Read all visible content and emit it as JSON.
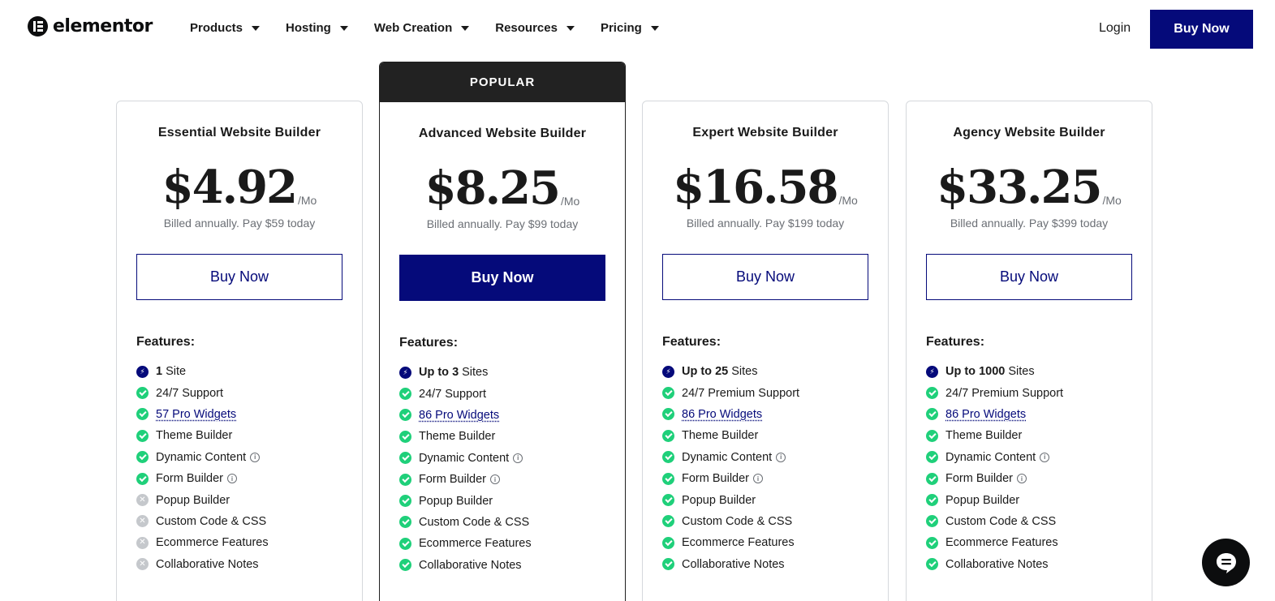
{
  "header": {
    "brand": "elementor",
    "nav": [
      {
        "label": "Products"
      },
      {
        "label": "Hosting"
      },
      {
        "label": "Web Creation"
      },
      {
        "label": "Resources"
      },
      {
        "label": "Pricing"
      }
    ],
    "login_label": "Login",
    "buy_label": "Buy Now",
    "accent_color": "#050a7a"
  },
  "plans": [
    {
      "title": "Essential Website Builder",
      "price": "$4.92",
      "per": "/Mo",
      "billed": "Billed annually. Pay $59 today",
      "cta": "Buy Now",
      "popular": false,
      "features_label": "Features:",
      "sites_bold": "1",
      "sites_text": "Site",
      "support": "24/7 Support",
      "widgets": "57 Pro Widgets",
      "features": [
        {
          "label": "Theme Builder",
          "status": "included",
          "info": false
        },
        {
          "label": "Dynamic Content",
          "status": "included",
          "info": true
        },
        {
          "label": "Form Builder",
          "status": "included",
          "info": true
        },
        {
          "label": "Popup Builder",
          "status": "excluded",
          "info": false
        },
        {
          "label": "Custom Code & CSS",
          "status": "excluded",
          "info": false
        },
        {
          "label": "Ecommerce Features",
          "status": "excluded",
          "info": false
        },
        {
          "label": "Collaborative Notes",
          "status": "excluded",
          "info": false
        }
      ]
    },
    {
      "title": "Advanced Website Builder",
      "price": "$8.25",
      "per": "/Mo",
      "billed": "Billed annually. Pay $99 today",
      "cta": "Buy Now",
      "popular": true,
      "popular_label": "POPULAR",
      "features_label": "Features:",
      "sites_bold": "Up to 3",
      "sites_text": "Sites",
      "support": "24/7 Support",
      "widgets": "86 Pro Widgets",
      "features": [
        {
          "label": "Theme Builder",
          "status": "included",
          "info": false
        },
        {
          "label": "Dynamic Content",
          "status": "included",
          "info": true
        },
        {
          "label": "Form Builder",
          "status": "included",
          "info": true
        },
        {
          "label": "Popup Builder",
          "status": "included",
          "info": false
        },
        {
          "label": "Custom Code & CSS",
          "status": "included",
          "info": false
        },
        {
          "label": "Ecommerce Features",
          "status": "included",
          "info": false
        },
        {
          "label": "Collaborative Notes",
          "status": "included",
          "info": false
        }
      ]
    },
    {
      "title": "Expert Website Builder",
      "price": "$16.58",
      "per": "/Mo",
      "billed": "Billed annually. Pay $199 today",
      "cta": "Buy Now",
      "popular": false,
      "features_label": "Features:",
      "sites_bold": "Up to 25",
      "sites_text": "Sites",
      "support": "24/7 Premium Support",
      "widgets": "86 Pro Widgets",
      "features": [
        {
          "label": "Theme Builder",
          "status": "included",
          "info": false
        },
        {
          "label": "Dynamic Content",
          "status": "included",
          "info": true
        },
        {
          "label": "Form Builder",
          "status": "included",
          "info": true
        },
        {
          "label": "Popup Builder",
          "status": "included",
          "info": false
        },
        {
          "label": "Custom Code & CSS",
          "status": "included",
          "info": false
        },
        {
          "label": "Ecommerce Features",
          "status": "included",
          "info": false
        },
        {
          "label": "Collaborative Notes",
          "status": "included",
          "info": false
        }
      ]
    },
    {
      "title": "Agency Website Builder",
      "price": "$33.25",
      "per": "/Mo",
      "billed": "Billed annually. Pay $399 today",
      "cta": "Buy Now",
      "popular": false,
      "features_label": "Features:",
      "sites_bold": "Up to 1000",
      "sites_text": "Sites",
      "support": "24/7 Premium Support",
      "widgets": "86 Pro Widgets",
      "features": [
        {
          "label": "Theme Builder",
          "status": "included",
          "info": false
        },
        {
          "label": "Dynamic Content",
          "status": "included",
          "info": true
        },
        {
          "label": "Form Builder",
          "status": "included",
          "info": true
        },
        {
          "label": "Popup Builder",
          "status": "included",
          "info": false
        },
        {
          "label": "Custom Code & CSS",
          "status": "included",
          "info": false
        },
        {
          "label": "Ecommerce Features",
          "status": "included",
          "info": false
        },
        {
          "label": "Collaborative Notes",
          "status": "included",
          "info": false
        }
      ]
    }
  ],
  "icons": {
    "included": "check-circle-icon",
    "excluded": "x-circle-icon",
    "sites": "bolt-icon",
    "info": "info-icon",
    "chat": "chat-icon"
  }
}
